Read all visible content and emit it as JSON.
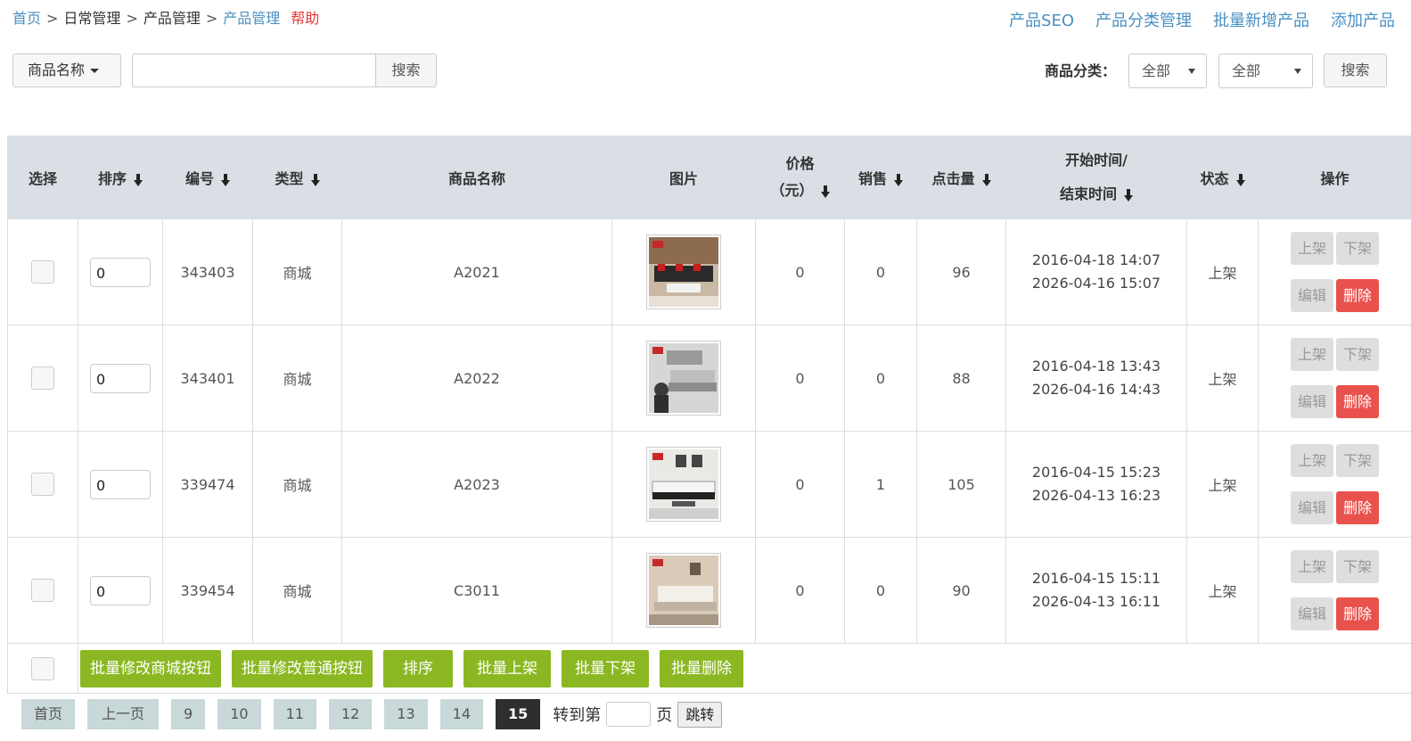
{
  "breadcrumb": {
    "home": "首页",
    "level1": "日常管理",
    "level2": "产品管理",
    "current": "产品管理",
    "help": "帮助",
    "separator": ">"
  },
  "top_links": [
    "产品SEO",
    "产品分类管理",
    "批量新增产品",
    "添加产品"
  ],
  "search": {
    "field_label": "商品名称",
    "input_value": "",
    "button_label": "搜索",
    "category_label": "商品分类：",
    "category_select1": "全部",
    "category_select2": "全部",
    "category_search_label": "搜索"
  },
  "table": {
    "headers": {
      "select": "选择",
      "sort": "排序",
      "id": "编号",
      "type": "类型",
      "name": "商品名称",
      "image": "图片",
      "price_line1": "价格",
      "price_line2": "（元）",
      "sales": "销售",
      "clicks": "点击量",
      "time_line1": "开始时间/",
      "time_line2": "结束时间",
      "status": "状态",
      "ops": "操作"
    },
    "op_labels": {
      "on_shelf": "上架",
      "off_shelf": "下架",
      "edit": "编辑",
      "delete": "删除"
    },
    "rows": [
      {
        "sort": "0",
        "id": "343403",
        "type": "商城",
        "name": "A2021",
        "price": "0",
        "sales": "0",
        "clicks": "96",
        "start": "2016-04-18 14:07",
        "end": "2026-04-16 15:07",
        "status": "上架"
      },
      {
        "sort": "0",
        "id": "343401",
        "type": "商城",
        "name": "A2022",
        "price": "0",
        "sales": "0",
        "clicks": "88",
        "start": "2016-04-18 13:43",
        "end": "2026-04-16 14:43",
        "status": "上架"
      },
      {
        "sort": "0",
        "id": "339474",
        "type": "商城",
        "name": "A2023",
        "price": "0",
        "sales": "1",
        "clicks": "105",
        "start": "2016-04-15 15:23",
        "end": "2026-04-13 16:23",
        "status": "上架"
      },
      {
        "sort": "0",
        "id": "339454",
        "type": "商城",
        "name": "C3011",
        "price": "0",
        "sales": "0",
        "clicks": "90",
        "start": "2016-04-15 15:11",
        "end": "2026-04-13 16:11",
        "status": "上架"
      }
    ]
  },
  "bulk_actions": [
    "批量修改商城按钮",
    "批量修改普通按钮",
    "排序",
    "批量上架",
    "批量下架",
    "批量删除"
  ],
  "pager": {
    "first": "首页",
    "prev": "上一页",
    "pages": [
      "9",
      "10",
      "11",
      "12",
      "13",
      "14"
    ],
    "current": "15",
    "goto_prefix": "转到第",
    "goto_suffix": "页",
    "jump": "跳转"
  }
}
